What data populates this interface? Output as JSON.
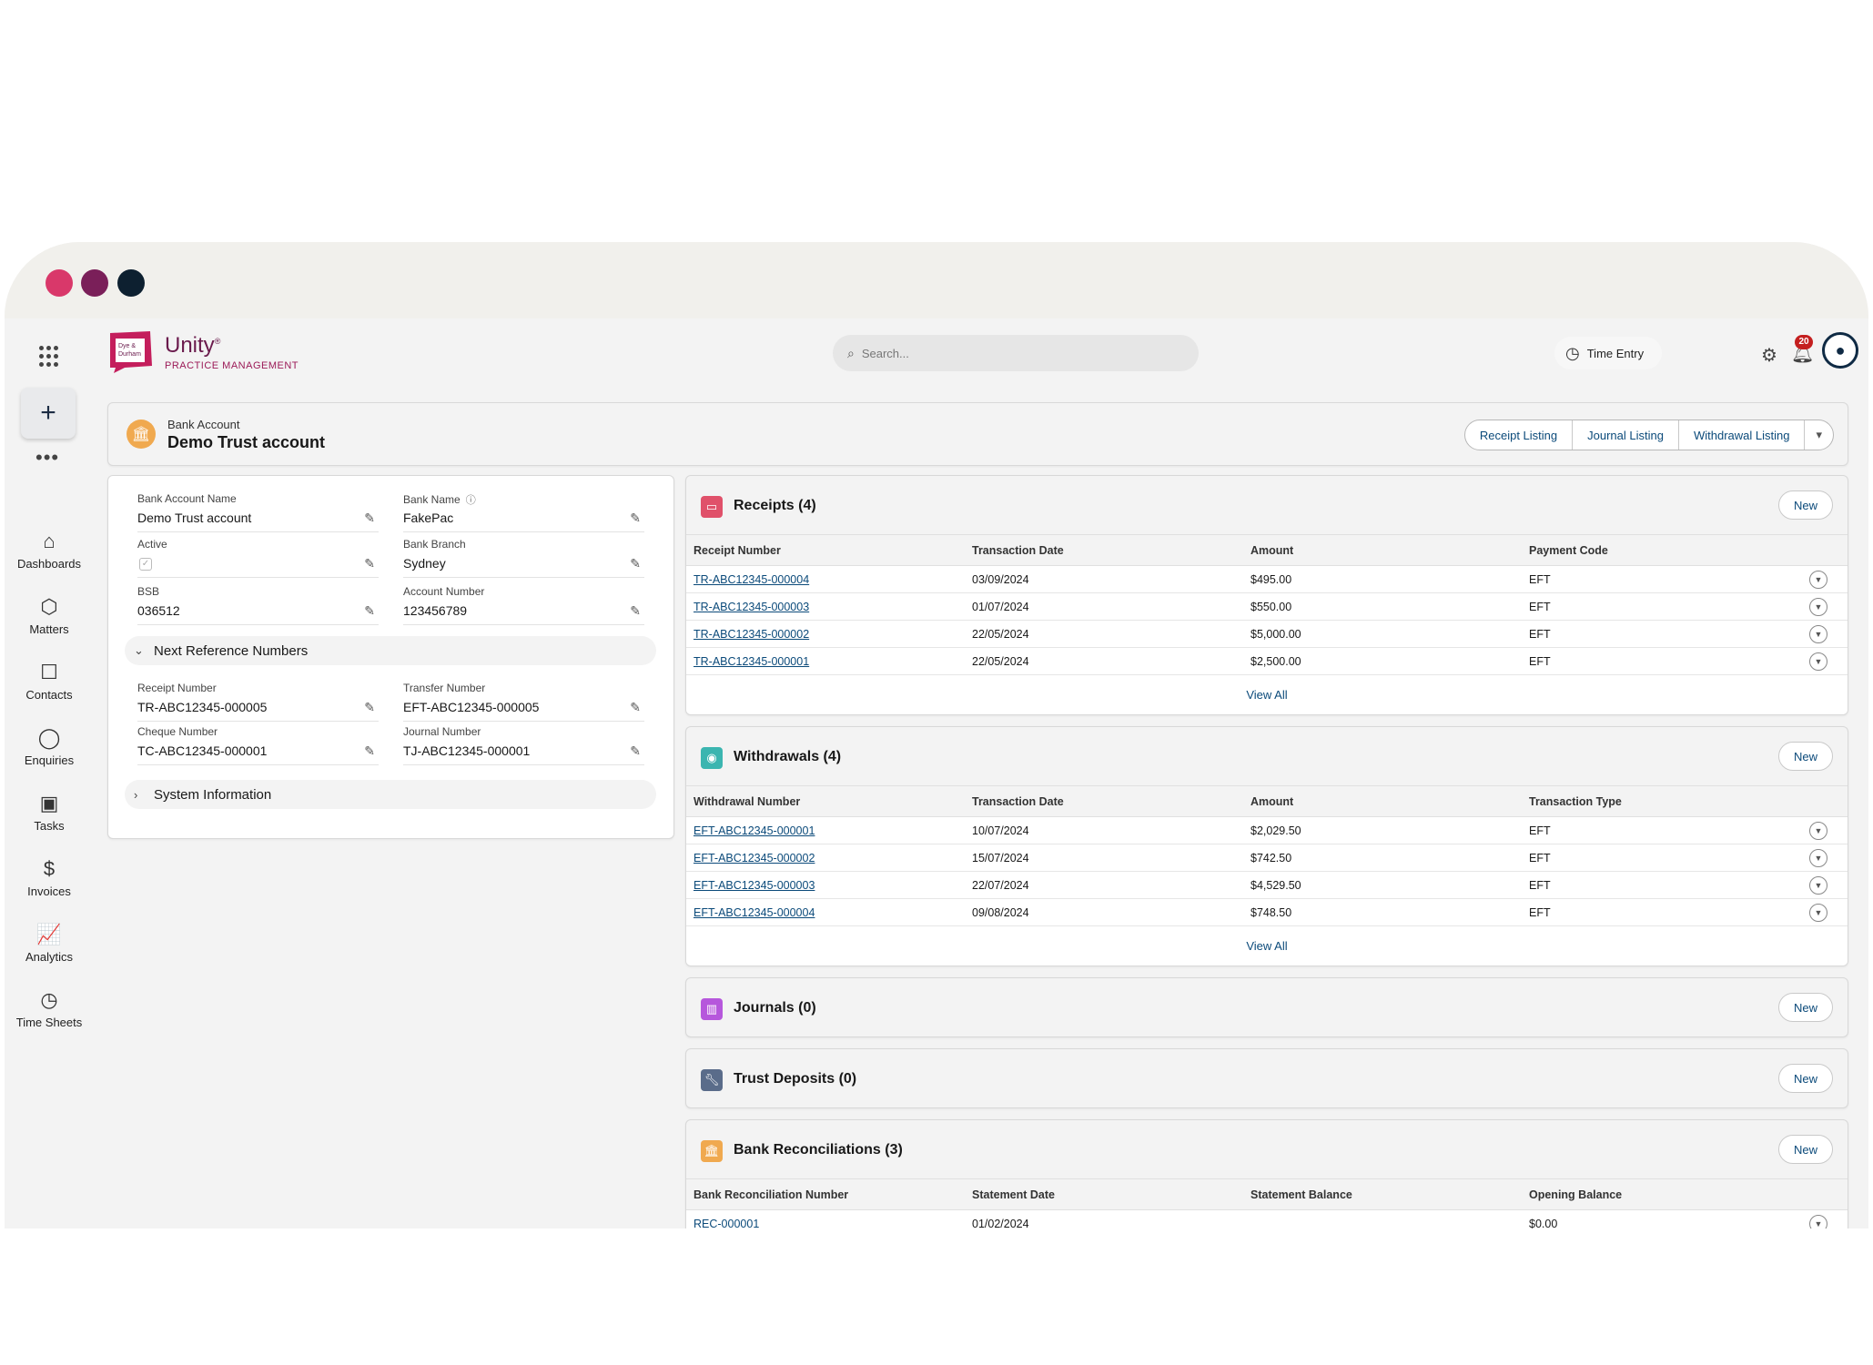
{
  "header": {
    "brand_name": "Unity",
    "brand_mark": "®",
    "brand_sub": "PRACTICE MANAGEMENT",
    "logo_text_1": "Dye &",
    "logo_text_2": "Durham",
    "search_placeholder": "Search...",
    "time_entry_label": "Time Entry",
    "notification_count": "20"
  },
  "nav": {
    "items": [
      {
        "label": "Dashboards",
        "icon": "home-icon"
      },
      {
        "label": "Matters",
        "icon": "matters-icon"
      },
      {
        "label": "Contacts",
        "icon": "contacts-icon"
      },
      {
        "label": "Enquiries",
        "icon": "lightbulb-icon"
      },
      {
        "label": "Tasks",
        "icon": "clipboard-icon"
      },
      {
        "label": "Invoices",
        "icon": "dollar-icon"
      },
      {
        "label": "Analytics",
        "icon": "chart-icon"
      },
      {
        "label": "Time Sheets",
        "icon": "clock-icon"
      }
    ]
  },
  "record": {
    "type_label": "Bank Account",
    "name": "Demo Trust account",
    "actions": [
      "Receipt Listing",
      "Journal Listing",
      "Withdrawal Listing"
    ]
  },
  "details": {
    "bank_account_name": {
      "label": "Bank Account Name",
      "value": "Demo Trust account"
    },
    "bank_name": {
      "label": "Bank Name",
      "value": "FakePac"
    },
    "active": {
      "label": "Active",
      "value": "✓"
    },
    "bank_branch": {
      "label": "Bank Branch",
      "value": "Sydney"
    },
    "bsb": {
      "label": "BSB",
      "value": "036512"
    },
    "account_number": {
      "label": "Account Number",
      "value": "123456789"
    },
    "next_ref_section": "Next Reference Numbers",
    "receipt_number": {
      "label": "Receipt Number",
      "value": "TR-ABC12345-000005"
    },
    "transfer_number": {
      "label": "Transfer Number",
      "value": "EFT-ABC12345-000005"
    },
    "cheque_number": {
      "label": "Cheque Number",
      "value": "TC-ABC12345-000001"
    },
    "journal_number": {
      "label": "Journal Number",
      "value": "TJ-ABC12345-000001"
    },
    "system_info_section": "System Information"
  },
  "receipts": {
    "title": "Receipts (4)",
    "new_label": "New",
    "view_all": "View All",
    "columns": [
      "Receipt Number",
      "Transaction Date",
      "Amount",
      "Payment Code"
    ],
    "rows": [
      [
        "TR-ABC12345-000004",
        "03/09/2024",
        "$495.00",
        "EFT"
      ],
      [
        "TR-ABC12345-000003",
        "01/07/2024",
        "$550.00",
        "EFT"
      ],
      [
        "TR-ABC12345-000002",
        "22/05/2024",
        "$5,000.00",
        "EFT"
      ],
      [
        "TR-ABC12345-000001",
        "22/05/2024",
        "$2,500.00",
        "EFT"
      ]
    ]
  },
  "withdrawals": {
    "title": "Withdrawals (4)",
    "new_label": "New",
    "view_all": "View All",
    "columns": [
      "Withdrawal Number",
      "Transaction Date",
      "Amount",
      "Transaction Type"
    ],
    "rows": [
      [
        "EFT-ABC12345-000001",
        "10/07/2024",
        "$2,029.50",
        "EFT"
      ],
      [
        "EFT-ABC12345-000002",
        "15/07/2024",
        "$742.50",
        "EFT"
      ],
      [
        "EFT-ABC12345-000003",
        "22/07/2024",
        "$4,529.50",
        "EFT"
      ],
      [
        "EFT-ABC12345-000004",
        "09/08/2024",
        "$748.50",
        "EFT"
      ]
    ]
  },
  "journals": {
    "title": "Journals (0)",
    "new_label": "New"
  },
  "trust_deposits": {
    "title": "Trust Deposits (0)",
    "new_label": "New"
  },
  "bank_reconciliations": {
    "title": "Bank Reconciliations (3)",
    "new_label": "New",
    "columns": [
      "Bank Reconciliation Number",
      "Statement Date",
      "Statement Balance",
      "Opening Balance"
    ],
    "rows": [
      [
        "REC-000001",
        "01/02/2024",
        "",
        "$0.00"
      ]
    ]
  },
  "colors": {
    "receipts_icon": "#e0516a",
    "withdrawals_icon": "#3bb5b0",
    "journals_icon": "#b657dc",
    "trust_deposits_icon": "#5a6c8a",
    "bank_rec_icon": "#f0a94f",
    "link": "#0b4a7a"
  }
}
